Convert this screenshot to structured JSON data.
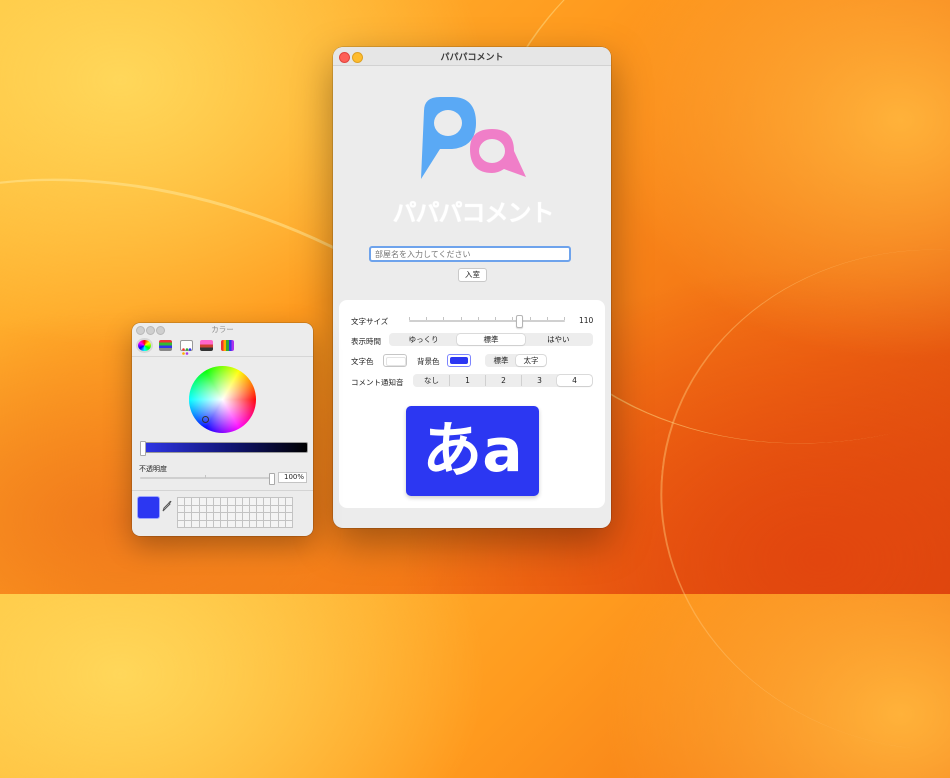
{
  "main_window": {
    "title": "パパパコメント",
    "logo_text": "パパパコメント",
    "colors": {
      "logo_blue": "#5aa9f5",
      "logo_pink": "#f07ec8",
      "accent": "#2c37f2"
    },
    "name_input": {
      "placeholder": "部屋名を入力してください",
      "value": ""
    },
    "enter_button": "入室",
    "settings": {
      "font_size": {
        "label": "文字サイズ",
        "value": "110",
        "slider_fraction": 0.69
      },
      "display_time": {
        "label": "表示時間",
        "options": [
          "ゆっくり",
          "標準",
          "はやい"
        ],
        "selected": "標準"
      },
      "text_color_label": "文字色",
      "bg_color_label": "背景色",
      "text_color": "#ffffff",
      "bg_color": "#2c37f2",
      "weight": {
        "options": [
          "標準",
          "太字"
        ],
        "selected": "太字"
      },
      "notification": {
        "label": "コメント通知音",
        "options": [
          "なし",
          "1",
          "2",
          "3",
          "4"
        ],
        "selected": "4"
      }
    },
    "preview_text": "あa"
  },
  "color_panel": {
    "title": "カラー",
    "modes": [
      "color-wheel-icon",
      "sliders-icon",
      "palettes-icon",
      "image-palettes-icon",
      "pencils-icon"
    ],
    "selected_mode": "color-wheel-icon",
    "opacity_label": "不透明度",
    "opacity_value": "100%",
    "opacity_fraction": 1.0,
    "current_color": "#2c37f2"
  }
}
